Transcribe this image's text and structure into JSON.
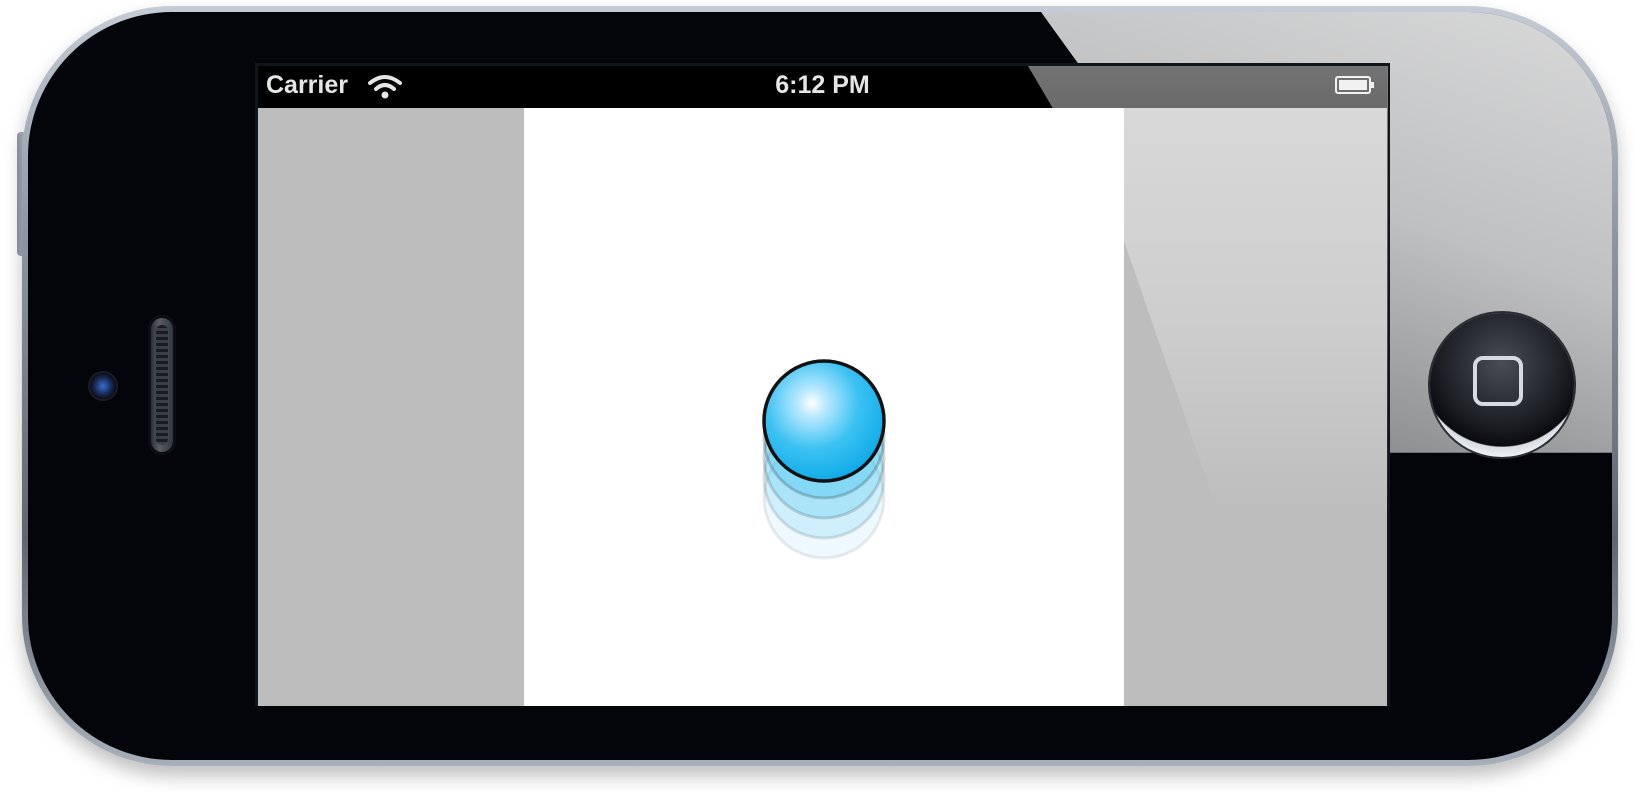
{
  "statusbar": {
    "carrier": "Carrier",
    "time": "6:12 PM",
    "wifi_icon": "wifi-icon",
    "battery_icon": "battery-icon"
  },
  "colors": {
    "ball_fill": "#1fb7ee",
    "ball_stroke": "#111111",
    "side_panel": "#bdbdbd",
    "center_background": "#ffffff",
    "status_bar": "#000000"
  },
  "hardware": {
    "home_button_icon": "home-button-icon",
    "camera_icon": "front-camera-icon",
    "speaker_icon": "earpiece-speaker-icon"
  }
}
